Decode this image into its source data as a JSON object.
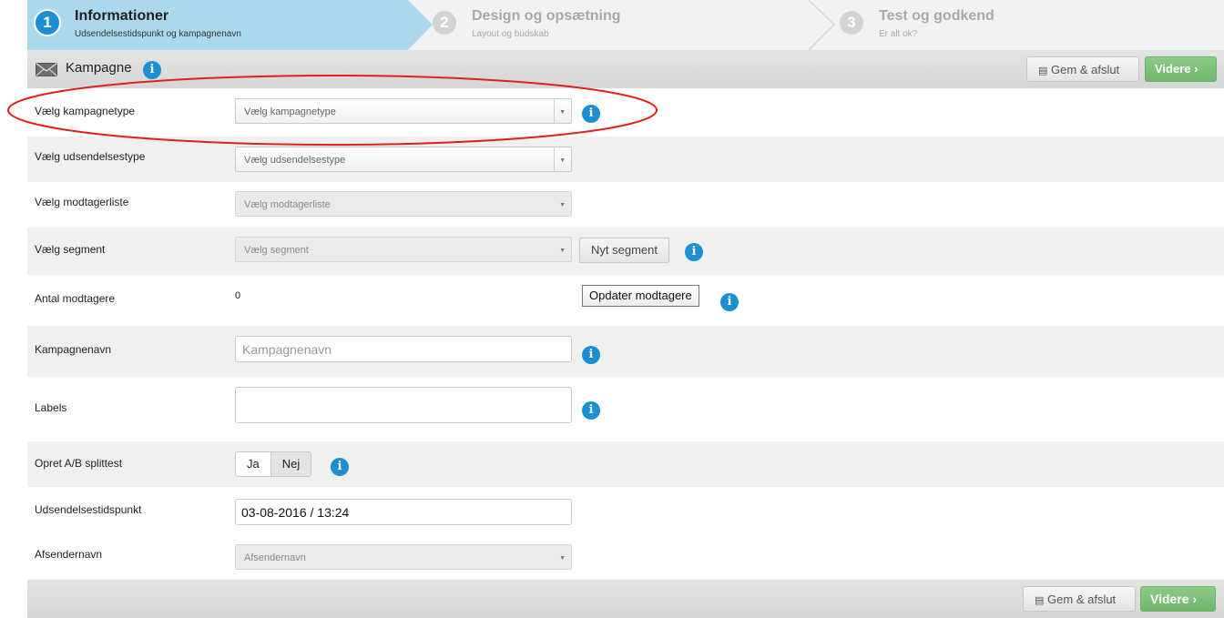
{
  "steps": [
    {
      "number": "1",
      "title": "Informationer",
      "subtitle": "Udsendelsestidspunkt og kampagnenavn"
    },
    {
      "number": "2",
      "title": "Design og opsætning",
      "subtitle": "Layout og budskab"
    },
    {
      "number": "3",
      "title": "Test og godkend",
      "subtitle": "Er alt ok?"
    }
  ],
  "header": {
    "title": "Kampagne",
    "save_label": "Gem & afslut",
    "next_label": "Videre"
  },
  "form": {
    "kampagnetype": {
      "label": "Vælg kampagnetype",
      "placeholder": "Vælg kampagnetype"
    },
    "udsendelsestype": {
      "label": "Vælg udsendelsestype",
      "placeholder": "Vælg udsendelsestype"
    },
    "modtagerliste": {
      "label": "Vælg modtagerliste",
      "placeholder": "Vælg modtagerliste"
    },
    "segment": {
      "label": "Vælg segment",
      "placeholder": "Vælg segment",
      "button": "Nyt segment"
    },
    "antal": {
      "label": "Antal modtagere",
      "value": "0",
      "button": "Opdater modtagere"
    },
    "kampagnenavn": {
      "label": "Kampagnenavn",
      "placeholder": "Kampagnenavn"
    },
    "labels": {
      "label": "Labels"
    },
    "splittest": {
      "label": "Opret A/B splittest",
      "yes": "Ja",
      "no": "Nej"
    },
    "tidspunkt": {
      "label": "Udsendelsestidspunkt",
      "value": "03-08-2016 / 13:24"
    },
    "afsender": {
      "label": "Afsendernavn",
      "placeholder": "Afsendernavn"
    }
  },
  "footer": {
    "save_label": "Gem & afslut",
    "next_label": "Videre"
  },
  "colors": {
    "accent": "#1b8fd2",
    "success": "#79bd74",
    "highlight": "#e0201b"
  }
}
